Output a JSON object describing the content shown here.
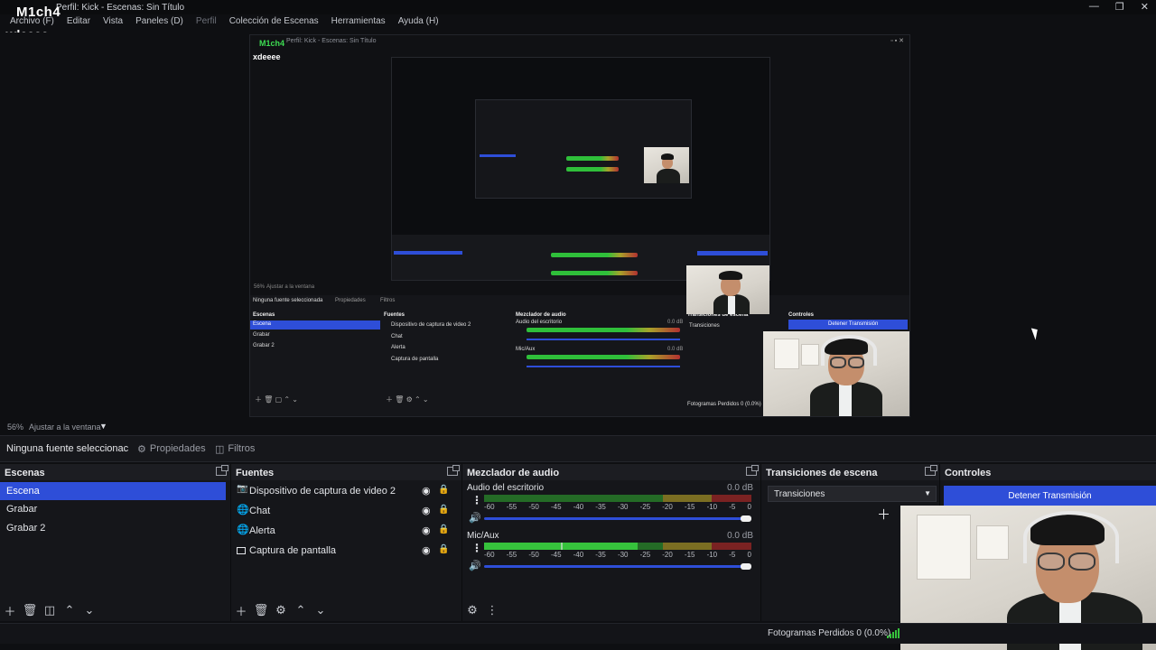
{
  "window": {
    "title": "Perfil: Kick - Escenas: Sin Título",
    "overlay_name": "M1ch4",
    "overlay_sub": "xdeeee",
    "controls": [
      "—",
      "❐",
      "✕"
    ]
  },
  "menu": [
    {
      "label": "Archivo (F)"
    },
    {
      "label": "Editar"
    },
    {
      "label": "Vista"
    },
    {
      "label": "Paneles (D)"
    },
    {
      "label": "Perfil"
    },
    {
      "label": "Colección de Escenas"
    },
    {
      "label": "Herramientas"
    },
    {
      "label": "Ayuda (H)"
    }
  ],
  "preview": {
    "nested_name": "M1ch4",
    "nested_sub": "xdeeee",
    "nested_title": "Perfil: Kick - Escenas: Sin Título",
    "nested_no_source": "Ninguna fuente seleccionada",
    "nested_props": "Propiedades",
    "nested_filters": "Filtros",
    "nested_scenes": "Escenas",
    "nested_sources": "Fuentes",
    "nested_mixer": "Mezclador de audio",
    "nested_transitions": "Transiciones de escena",
    "nested_controls": "Controles",
    "nested_stop": "Detener Transmisión",
    "nested_frames": "Fotogramas Perdidos 0 (0.0%)",
    "nested_zoom": "56%",
    "nested_fit": "Ajustar a la ventana",
    "nested_scene_items": [
      "Escena",
      "Grabar",
      "Grabar 2"
    ],
    "nested_source_items": [
      "Dispositivo de captura de video 2",
      "Chat",
      "Alerta",
      "Captura de pantalla"
    ],
    "nested_desktop": "Audio del escritorio",
    "nested_mic": "Mic/Aux",
    "nested_db": "0.0 dB",
    "nested_transitions_select": "Transiciones"
  },
  "status_line": {
    "zoom": "56%",
    "fit": "Ajustar a la ventana",
    "caret": "▼"
  },
  "source_toolbar": {
    "no_source": "Ninguna fuente seleccionac",
    "properties": "Propiedades",
    "filters": "Filtros"
  },
  "docks": {
    "scenes": {
      "title": "Escenas",
      "items": [
        "Escena",
        "Grabar",
        "Grabar 2"
      ],
      "selected_index": 0
    },
    "sources": {
      "title": "Fuentes",
      "items": [
        {
          "label": "Dispositivo de captura de video 2",
          "icon": "camera-icon"
        },
        {
          "label": "Chat",
          "icon": "globe-icon"
        },
        {
          "label": "Alerta",
          "icon": "globe-icon"
        },
        {
          "label": "Captura de pantalla",
          "icon": "monitor-icon"
        }
      ]
    },
    "mixer": {
      "title": "Mezclador de audio",
      "channels": [
        {
          "name": "Audio del escritorio",
          "db": "0.0 dB",
          "level": 0.0,
          "volume": 1.0
        },
        {
          "name": "Mic/Aux",
          "db": "0.0 dB",
          "level": 0.57,
          "volume": 1.0
        }
      ],
      "ticks": [
        "-60",
        "-55",
        "-50",
        "-45",
        "-40",
        "-35",
        "-30",
        "-25",
        "-20",
        "-15",
        "-10",
        "-5",
        "0"
      ]
    },
    "transitions": {
      "title": "Transiciones de escena",
      "selected": "Transiciones"
    },
    "controls": {
      "title": "Controles",
      "stop_stream": "Detener Transmisión"
    }
  },
  "status_bar": {
    "frames": "Fotogramas Perdidos 0 (0.0%)"
  },
  "colors": {
    "accent": "#2e4ed8",
    "meter_green": "#36c23c",
    "meter_yellow": "#7b6e22",
    "meter_red": "#7a2222",
    "overlay_green": "#3ddc52"
  }
}
